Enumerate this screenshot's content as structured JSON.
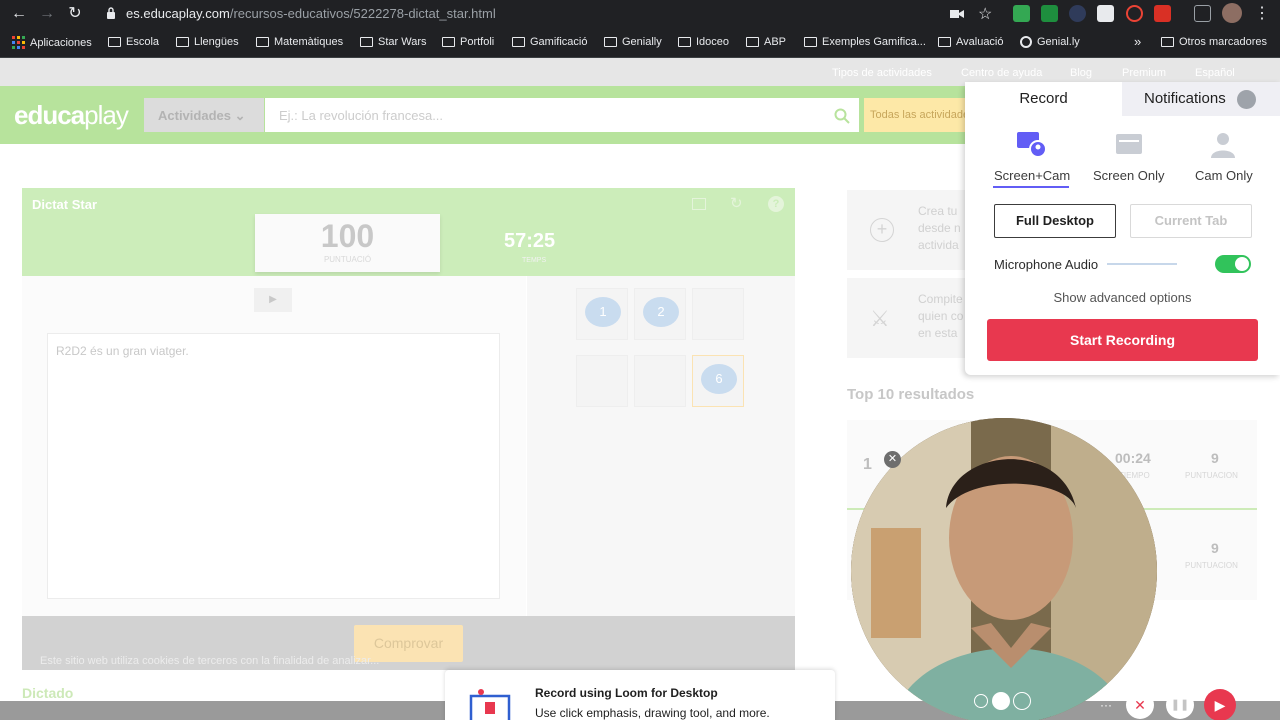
{
  "browser": {
    "url_host": "es.educaplay.com",
    "url_path": "/recursos-educativos/5222278-dictat_star.html",
    "nav": {
      "back": "←",
      "forward": "→",
      "reload": "↻"
    },
    "bookmarks": [
      "Aplicaciones",
      "Escola",
      "Llengües",
      "Matemàtiques",
      "Star Wars",
      "Portfoli",
      "Gamificació",
      "Genially",
      "Idoceo",
      "ABP",
      "Exemples Gamifica...",
      "Avaluació",
      "Genial.ly"
    ],
    "bookmarks_more": "»",
    "other_bookmarks": "Otros marcadores"
  },
  "site": {
    "top_links": [
      "Tipos de actividades",
      "Centro de ayuda",
      "Blog",
      "Premium",
      "Español"
    ],
    "logo_a": "educa",
    "logo_b": "play",
    "activities_label": "Actividades",
    "search_placeholder": "Ej.: La revolución francesa...",
    "all_activities": "Todas las actividades"
  },
  "game": {
    "title": "Dictat Star",
    "score": "100",
    "score_label": "PUNTUACIÓ",
    "time": "57:25",
    "time_label": "TEMPS",
    "answer_text": "R2D2 és un gran viatger.",
    "tiles": [
      "1",
      "2",
      "",
      "",
      "",
      "6"
    ],
    "check_label": "Comprovar",
    "section_title": "Dictado"
  },
  "sidebar": {
    "card1_text": [
      "Crea tu",
      "desde n",
      "activida"
    ],
    "card2_text": [
      "Compite",
      "quien co",
      "en esta"
    ],
    "top10_title": "Top 10 resultados",
    "results": [
      {
        "rank": "1",
        "time": "00:24",
        "time_label": "TIEMPO",
        "score": "9",
        "score_label": "PUNTUACION"
      },
      {
        "rank": "",
        "time": "",
        "time_label": "",
        "score": "9",
        "score_label": "PUNTUACION"
      }
    ]
  },
  "cookie_text": "Este sitio web utiliza cookies de terceros con la finalidad de analizar...",
  "loom": {
    "tab_record": "Record",
    "tab_notifications": "Notifications",
    "modes": [
      "Screen+Cam",
      "Screen Only",
      "Cam Only"
    ],
    "full_desktop": "Full Desktop",
    "current_tab": "Current Tab",
    "mic_label": "Microphone Audio",
    "mic_enabled": true,
    "advanced": "Show advanced options",
    "start": "Start Recording",
    "promo_title": "Record using Loom for Desktop",
    "promo_sub": "Use click emphasis, drawing tool, and more.",
    "controls": {
      "more": "···",
      "cancel": "✕",
      "pause": "❚❚",
      "record": "▶"
    },
    "cam_close": "✕",
    "colors": {
      "accent": "#625df5",
      "start": "#e8384f",
      "toggle": "#31c35b"
    }
  }
}
